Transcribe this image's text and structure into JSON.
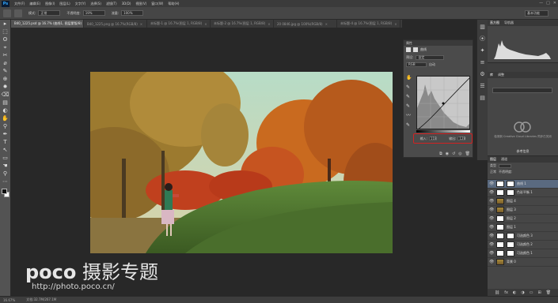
{
  "app": {
    "logo": "Ps"
  },
  "menu": {
    "items": [
      "文件(F)",
      "编辑(E)",
      "图像(I)",
      "图层(L)",
      "文字(Y)",
      "选择(S)",
      "滤镜(T)",
      "3D(D)",
      "视图(V)",
      "窗口(W)",
      "帮助(H)"
    ],
    "window_buttons": [
      "—",
      "□",
      "✕"
    ]
  },
  "options": {
    "mode_label": "模式:",
    "mode_value": "正常",
    "opacity_label": "不透明度:",
    "opacity_value": "19%",
    "flow_label": "流量:",
    "flow_value": "100%",
    "workspace": "基本功能"
  },
  "tabs": [
    {
      "label": "B40_1225.psd @ 16.7% (曲线1, 图层蒙版/8)",
      "active": true
    },
    {
      "label": "B40_1225.png @ 16.7%(RGB/8)",
      "active": false
    },
    {
      "label": "未标题-1 @ 16.7%(图层 1, RGB/8)",
      "active": false
    },
    {
      "label": "未标题-2 @ 16.7%(图层 1, RGB/8)",
      "active": false
    },
    {
      "label": "20 0846.jpg @ 100%(RGB/8)",
      "active": false
    },
    {
      "label": "未标题-4 @ 16.7%(图层 1, RGB/8)",
      "active": false
    }
  ],
  "tools": [
    "▸",
    "⬚",
    "ʘ",
    "⌖",
    "✂",
    "⌀",
    "✎",
    "⊕",
    "✹",
    "⌫",
    "▤",
    "◐",
    "✋",
    "⚲",
    "✒",
    "T",
    "↖",
    "▭",
    "☚",
    "⚲",
    "⋯"
  ],
  "properties": {
    "title": "属性",
    "type": "曲线",
    "preset_label": "预设:",
    "preset_value": "自定",
    "channel_value": "RGB",
    "auto_label": "自动",
    "curve_tools": [
      "✋",
      "✎",
      "✎",
      "✎",
      "〰",
      "✎"
    ],
    "input_label": "输入:",
    "input_value": "118",
    "output_label": "输出:",
    "output_value": "128",
    "footer_icons": [
      "⧉",
      "◉",
      "↺",
      "◎",
      "🗑"
    ]
  },
  "dock_icons": [
    "▥",
    "⦿",
    "✦",
    "≡",
    "⚙",
    "☰",
    "▤"
  ],
  "histogram": {
    "tabs": [
      "直方图",
      "导航器"
    ]
  },
  "library": {
    "tabs": [
      "库",
      "调整"
    ],
    "message": "检测到 Creative Cloud Libraries 同步已关闭",
    "button": "参考信息"
  },
  "layers": {
    "tabs": [
      "图层",
      "通道"
    ],
    "kind_label": "类型",
    "blend_label": "正常",
    "opacity_label": "不透明度:",
    "fill_label": "填充:",
    "items": [
      {
        "name": "曲线 1",
        "type": "adj",
        "selected": true
      },
      {
        "name": "色彩平衡 1",
        "type": "adj",
        "selected": false
      },
      {
        "name": "图层 4",
        "type": "photo",
        "selected": false
      },
      {
        "name": "图层 3",
        "type": "photo",
        "selected": false
      },
      {
        "name": "图层 2",
        "type": "white",
        "selected": false
      },
      {
        "name": "图层 1",
        "type": "white",
        "selected": false
      },
      {
        "name": "可选颜色 3",
        "type": "adj",
        "selected": false
      },
      {
        "name": "可选颜色 2",
        "type": "adj",
        "selected": false
      },
      {
        "name": "可选颜色 1",
        "type": "adj",
        "selected": false
      },
      {
        "name": "背景 0",
        "type": "photo",
        "selected": false
      }
    ],
    "footer_icons": [
      "⛓",
      "fx",
      "◐",
      "◑",
      "▭",
      "⊞",
      "🗑"
    ]
  },
  "watermark": {
    "brand_en": "poco",
    "brand_cn": "摄影专题",
    "url": "http://photo.poco.cn/"
  },
  "status": {
    "zoom": "16.67%",
    "doc": "文档:32.7M/267.1M"
  }
}
